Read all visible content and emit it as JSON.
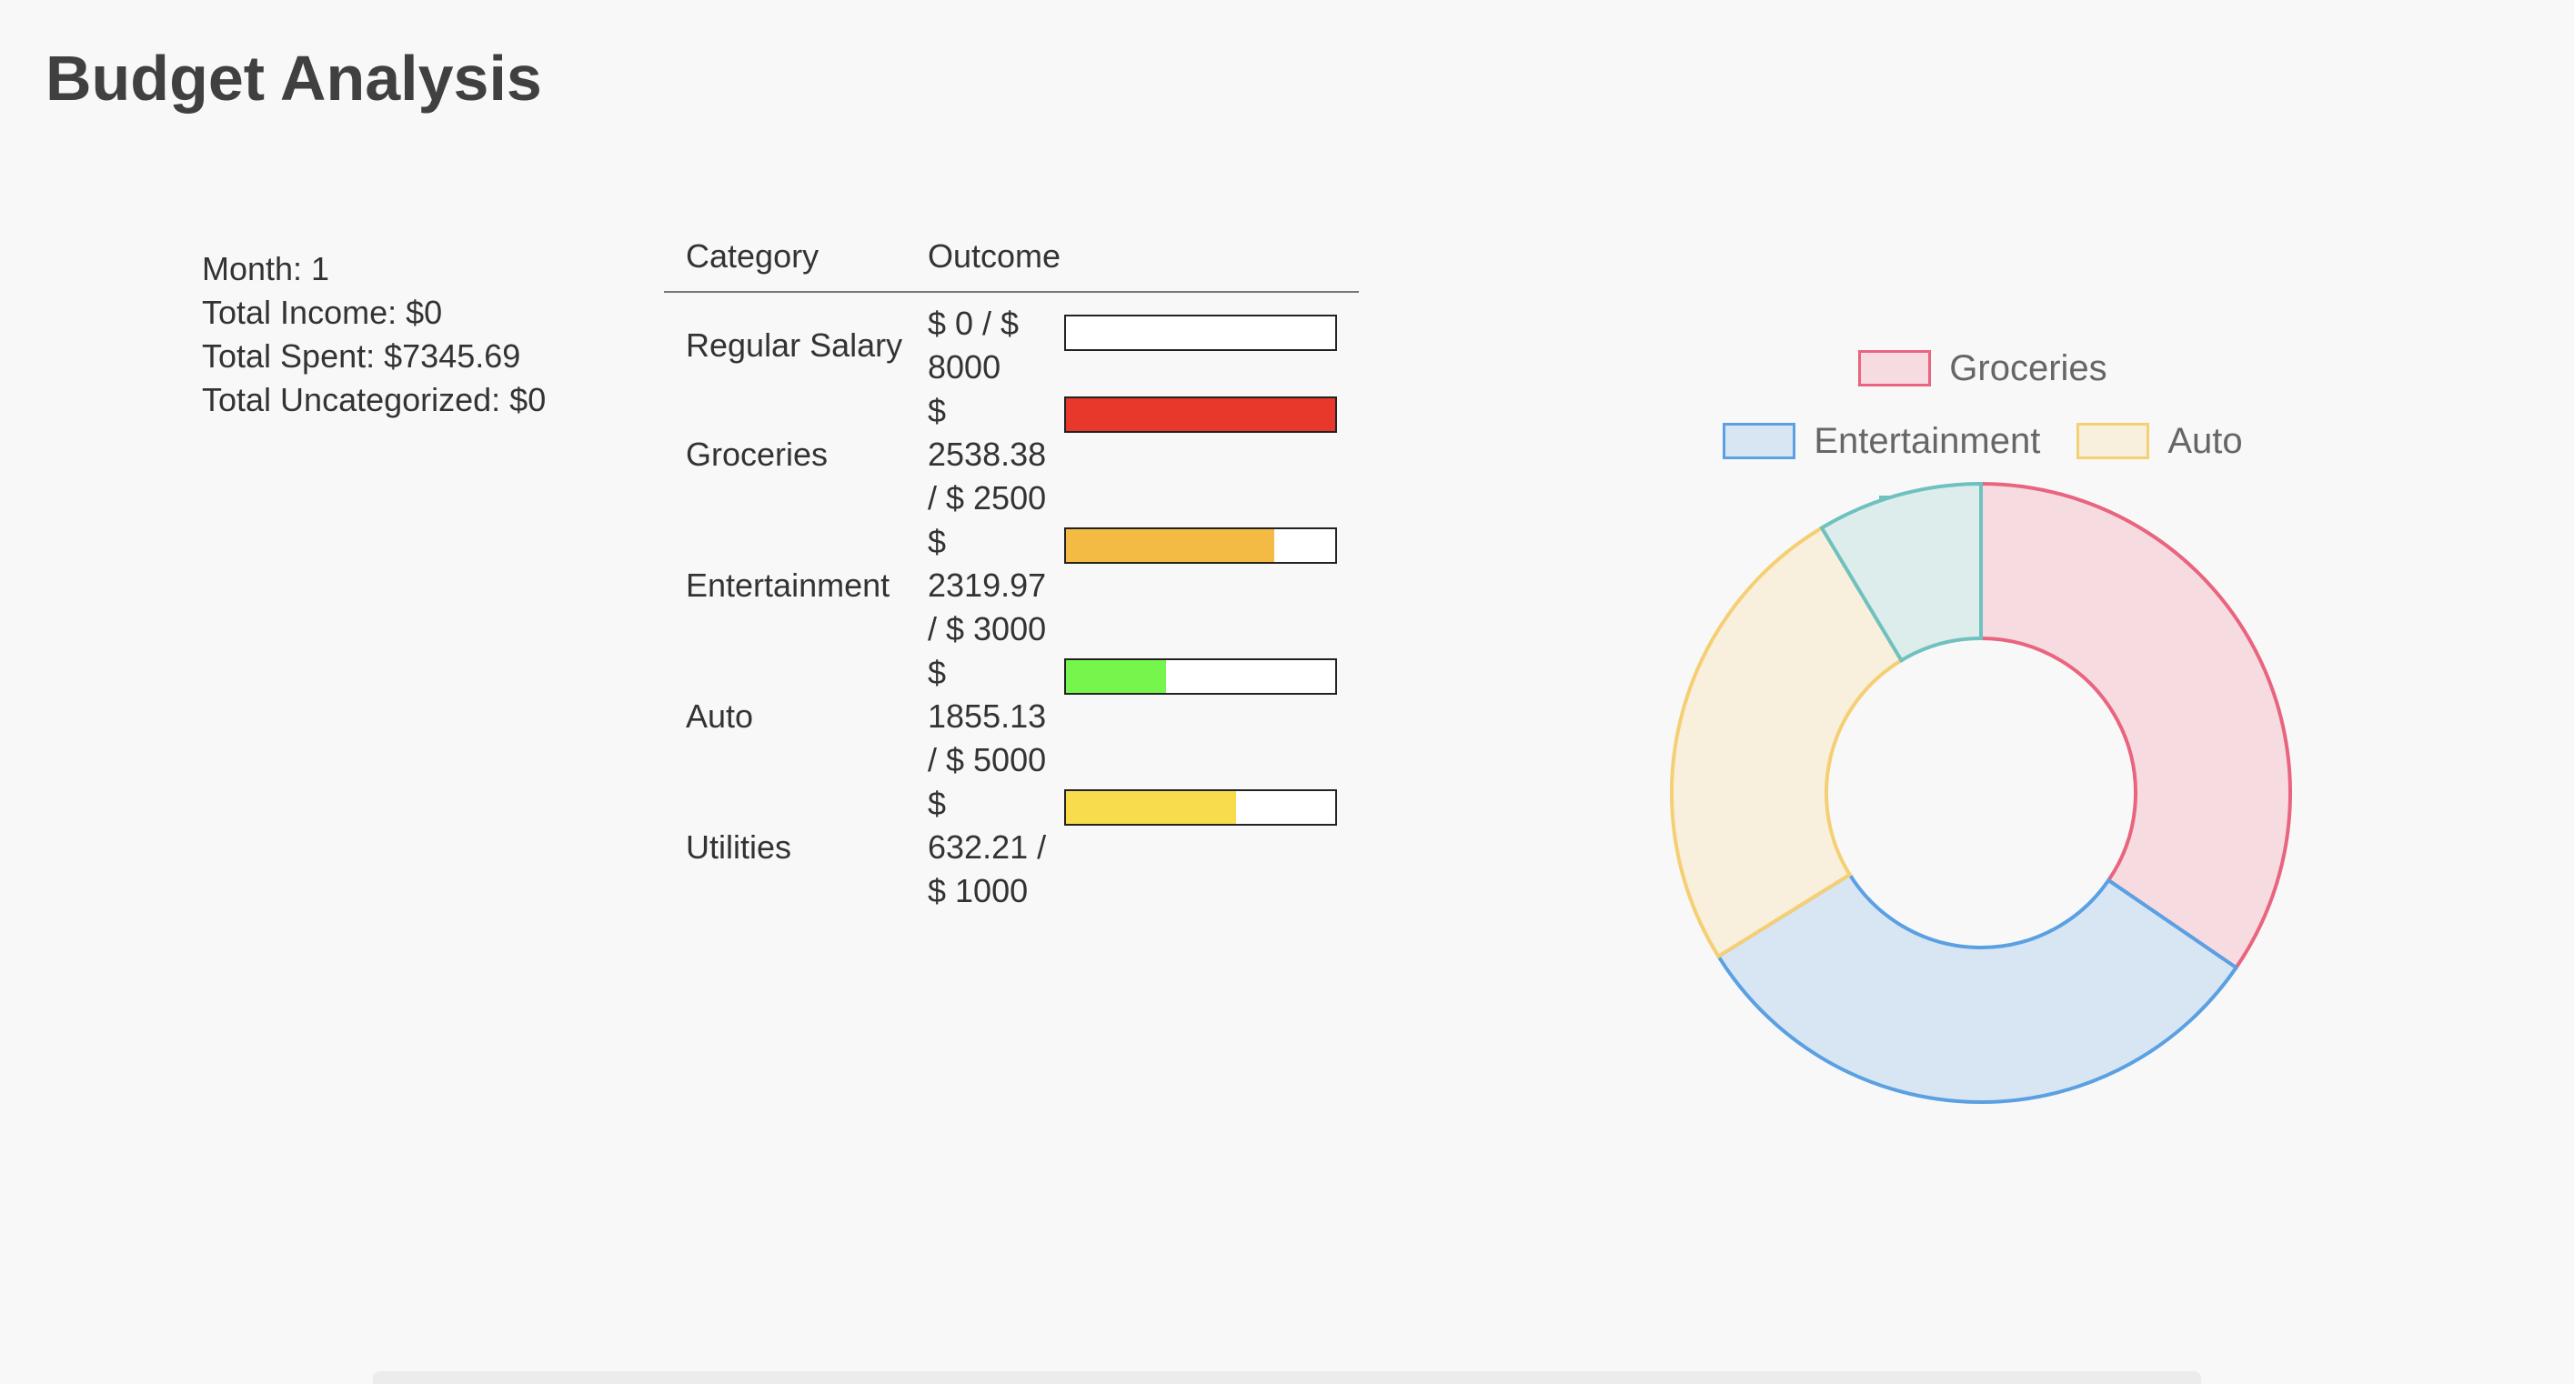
{
  "page": {
    "title": "Budget Analysis"
  },
  "summary": {
    "month": "Month: 1",
    "total_income": "Total Income: $0",
    "total_spent": "Total Spent: $7345.69",
    "total_uncategorized": "Total Uncategorized: $0"
  },
  "table": {
    "headers": {
      "category": "Category",
      "outcome": "Outcome"
    },
    "rows": [
      {
        "category": "Regular Salary",
        "outcome": "$ 0 / $ 8000",
        "spent": 0,
        "budget": 8000,
        "color": "#ffffff"
      },
      {
        "category": "Groceries",
        "outcome": "$ 2538.38 / $ 2500",
        "spent": 2538.38,
        "budget": 2500,
        "color": "#e8372b"
      },
      {
        "category": "Entertainment",
        "outcome": "$ 2319.97 / $ 3000",
        "spent": 2319.97,
        "budget": 3000,
        "color": "#f4bb44"
      },
      {
        "category": "Auto",
        "outcome": "$ 1855.13 / $ 5000",
        "spent": 1855.13,
        "budget": 5000,
        "color": "#76f54c"
      },
      {
        "category": "Utilities",
        "outcome": "$ 632.21 / $ 1000",
        "spent": 632.21,
        "budget": 1000,
        "color": "#f8dc4c"
      }
    ]
  },
  "chart_data": {
    "type": "pie",
    "categories": [
      "Groceries",
      "Entertainment",
      "Auto",
      "Utilities"
    ],
    "values": [
      2538.38,
      2319.97,
      1855.13,
      632.21
    ],
    "colors": {
      "Groceries": {
        "fill": "#f6dce1",
        "stroke": "#e9647f"
      },
      "Entertainment": {
        "fill": "#d8e6f4",
        "stroke": "#5aa0e2"
      },
      "Auto": {
        "fill": "#f8efdc",
        "stroke": "#f5cf73"
      },
      "Utilities": {
        "fill": "#dcedeb",
        "stroke": "#6fc1c0"
      }
    },
    "donut": true,
    "legend": "top"
  }
}
